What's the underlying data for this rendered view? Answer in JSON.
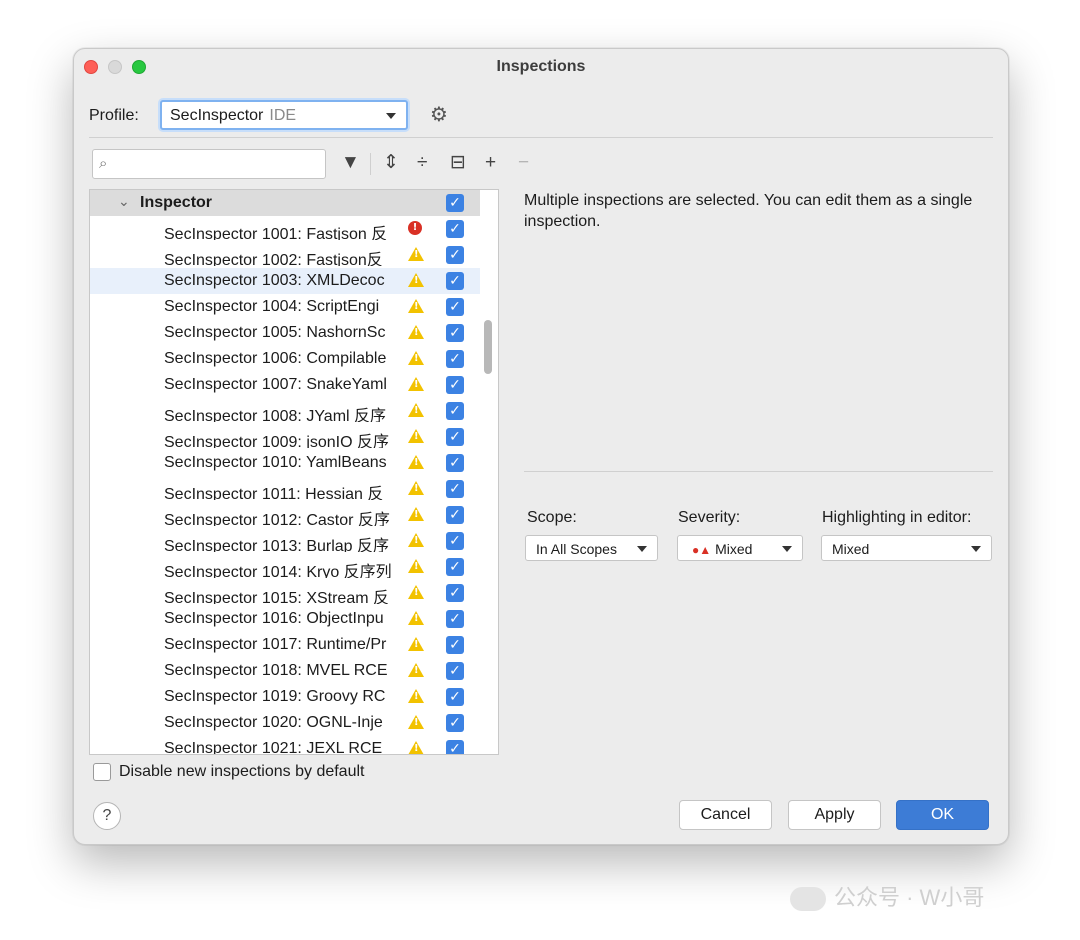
{
  "window": {
    "title": "Inspections"
  },
  "profile": {
    "label": "Profile:",
    "name": "SecInspector",
    "scope": "IDE"
  },
  "toolbar": {
    "search_placeholder": "",
    "add": "+",
    "remove": "−"
  },
  "tree": {
    "group": "Inspector",
    "items": [
      {
        "label": "SecInspector 1001: Fastjson 反",
        "severity": "error",
        "checked": true
      },
      {
        "label": "SecInspector 1002: Fastjson反",
        "severity": "warning",
        "checked": true
      },
      {
        "label": "SecInspector 1003: XMLDecoc",
        "severity": "warning",
        "checked": true
      },
      {
        "label": "SecInspector 1004: ScriptEngi",
        "severity": "warning",
        "checked": true
      },
      {
        "label": "SecInspector 1005: NashornSc",
        "severity": "warning",
        "checked": true
      },
      {
        "label": "SecInspector 1006: Compilable",
        "severity": "warning",
        "checked": true
      },
      {
        "label": "SecInspector 1007: SnakeYaml",
        "severity": "warning",
        "checked": true
      },
      {
        "label": "SecInspector 1008: JYaml 反序",
        "severity": "warning",
        "checked": true
      },
      {
        "label": "SecInspector 1009: jsonIO 反序",
        "severity": "warning",
        "checked": true
      },
      {
        "label": "SecInspector 1010: YamlBeans",
        "severity": "warning",
        "checked": true
      },
      {
        "label": "SecInspector 1011: Hessian 反",
        "severity": "warning",
        "checked": true
      },
      {
        "label": "SecInspector 1012: Castor 反序",
        "severity": "warning",
        "checked": true
      },
      {
        "label": "SecInspector 1013: Burlap 反序",
        "severity": "warning",
        "checked": true
      },
      {
        "label": "SecInspector 1014: Kryo 反序列",
        "severity": "warning",
        "checked": true
      },
      {
        "label": "SecInspector 1015: XStream 反",
        "severity": "warning",
        "checked": true
      },
      {
        "label": "SecInspector 1016: ObjectInpu",
        "severity": "warning",
        "checked": true
      },
      {
        "label": "SecInspector 1017: Runtime/Pr",
        "severity": "warning",
        "checked": true
      },
      {
        "label": "SecInspector 1018: MVEL RCE",
        "severity": "warning",
        "checked": true
      },
      {
        "label": "SecInspector 1019: Groovy RC",
        "severity": "warning",
        "checked": true
      },
      {
        "label": "SecInspector 1020: OGNL-Inje",
        "severity": "warning",
        "checked": true
      },
      {
        "label": "SecInspector 1021: JEXL RCE",
        "severity": "warning",
        "checked": true
      }
    ],
    "selected_index": 2
  },
  "description": "Multiple inspections are selected. You can edit them as a single inspection.",
  "options": {
    "scope_label": "Scope:",
    "scope_value": "In All Scopes",
    "severity_label": "Severity:",
    "severity_value": "Mixed",
    "highlight_label": "Highlighting in editor:",
    "highlight_value": "Mixed"
  },
  "disable_new": {
    "label": "Disable new inspections by default",
    "checked": false
  },
  "buttons": {
    "help": "?",
    "cancel": "Cancel",
    "apply": "Apply",
    "ok": "OK"
  },
  "watermark": "公众号 · W小哥",
  "colors": {
    "accent": "#3d7cd6",
    "warning": "#f2c200",
    "error": "#d93025"
  }
}
